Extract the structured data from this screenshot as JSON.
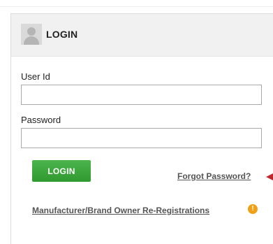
{
  "header": {
    "title": "LOGIN",
    "avatar_icon": "user-avatar-icon"
  },
  "form": {
    "user_id_label": "User Id",
    "user_id_value": "",
    "password_label": "Password",
    "password_value": "",
    "login_button": "LOGIN"
  },
  "links": {
    "forgot_password": "Forgot Password?",
    "reregistration": "Manufacturer/Brand Owner Re-Registrations"
  },
  "icons": {
    "info": "info-icon",
    "info_glyph": "!",
    "pointer": "arrow-pointer-icon"
  },
  "colors": {
    "login_button": "#3aa63a",
    "info_icon": "#f0a016",
    "pointer_arrow": "#c0262b",
    "header_bg": "#f1f1f1"
  }
}
